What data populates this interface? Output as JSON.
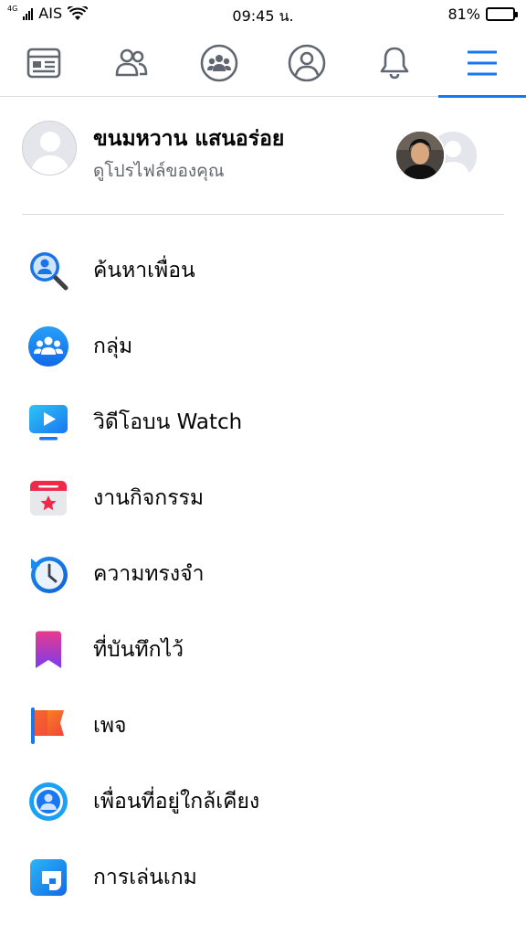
{
  "status_bar": {
    "network": "4G",
    "carrier": "AIS",
    "time": "09:45 น.",
    "battery_percent": "81%",
    "battery_level": 0.81
  },
  "tabs": [
    {
      "icon": "news-feed-icon",
      "active": false
    },
    {
      "icon": "friends-icon",
      "active": false
    },
    {
      "icon": "groups-icon",
      "active": false
    },
    {
      "icon": "profile-icon",
      "active": false
    },
    {
      "icon": "bell-icon",
      "active": false
    },
    {
      "icon": "menu-icon",
      "active": true
    }
  ],
  "profile": {
    "name": "ขนมหวาน แสนอร่อย",
    "subtitle": "ดูโปรไฟล์ของคุณ"
  },
  "menu": [
    {
      "label": "ค้นหาเพื่อน",
      "icon": "find-friends-icon"
    },
    {
      "label": "กลุ่ม",
      "icon": "groups-icon"
    },
    {
      "label": "วิดีโอบน Watch",
      "icon": "watch-icon"
    },
    {
      "label": "งานกิจกรรม",
      "icon": "events-icon"
    },
    {
      "label": "ความทรงจำ",
      "icon": "memories-icon"
    },
    {
      "label": "ที่บันทึกไว้",
      "icon": "saved-icon"
    },
    {
      "label": "เพจ",
      "icon": "pages-icon"
    },
    {
      "label": "เพื่อนที่อยู่ใกล้เคียง",
      "icon": "nearby-friends-icon"
    },
    {
      "label": "การเล่นเกม",
      "icon": "gaming-icon"
    }
  ],
  "colors": {
    "accent": "#1877f2",
    "tab_icon": "#606770",
    "text": "#050505",
    "secondary_text": "#65676b"
  }
}
